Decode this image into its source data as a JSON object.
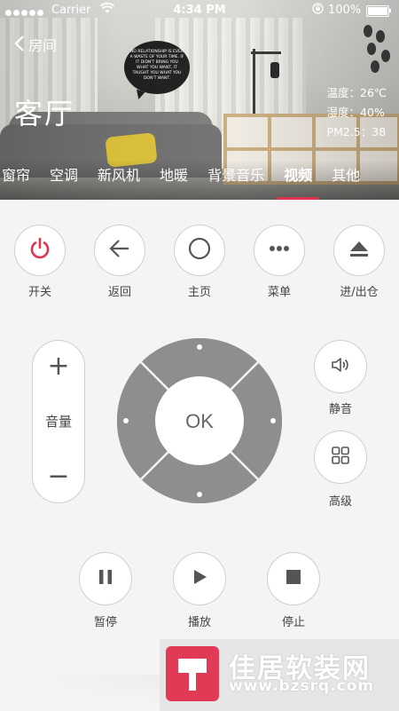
{
  "status_bar": {
    "carrier": "Carrier",
    "time": "4:34 PM",
    "battery": "100%"
  },
  "header": {
    "back_label": "房间",
    "room_name": "客厅",
    "bubble_text": "NO RELATIONSHIP IS EVER A WASTE OF YOUR TIME. IF IT DIDN'T BRING YOU WHAT YOU WANT, IT TAUGHT YOU WHAT YOU DON'T WANT.",
    "temperature": "温度：26℃",
    "humidity": "湿度：40%",
    "pm25": "PM2.5：38"
  },
  "tabs": [
    {
      "label": "窗帘",
      "active": false
    },
    {
      "label": "空调",
      "active": false
    },
    {
      "label": "新风机",
      "active": false
    },
    {
      "label": "地暖",
      "active": false
    },
    {
      "label": "背景音乐",
      "active": false
    },
    {
      "label": "视频",
      "active": true
    },
    {
      "label": "其他",
      "active": false
    }
  ],
  "top_buttons": [
    {
      "label": "开关",
      "icon": "power-icon"
    },
    {
      "label": "返回",
      "icon": "arrow-left-icon"
    },
    {
      "label": "主页",
      "icon": "home-circle-icon"
    },
    {
      "label": "菜单",
      "icon": "more-dots-icon"
    },
    {
      "label": "进/出仓",
      "icon": "eject-icon"
    }
  ],
  "volume": {
    "plus": "+",
    "label": "音量",
    "minus": "−"
  },
  "dpad": {
    "ok_label": "OK"
  },
  "side_buttons": [
    {
      "label": "静音",
      "icon": "mute-speaker-icon"
    },
    {
      "label": "高级",
      "icon": "grid-icon"
    }
  ],
  "playback_buttons": [
    {
      "label": "暂停",
      "icon": "pause-icon"
    },
    {
      "label": "播放",
      "icon": "play-icon"
    },
    {
      "label": "停止",
      "icon": "stop-icon"
    }
  ],
  "watermark": {
    "line1": "佳居软装网",
    "line2": "www.bzsrq.com"
  },
  "colors": {
    "accent": "#e0344e",
    "dpad": "#8e8e8e",
    "icon": "#555555"
  }
}
